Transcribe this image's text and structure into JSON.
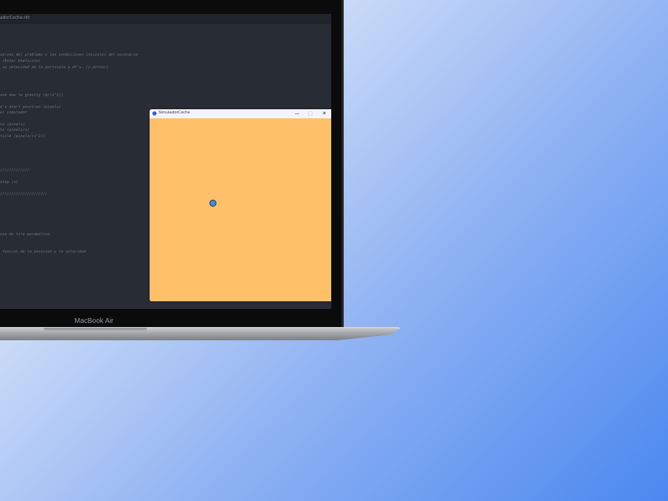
{
  "device": {
    "model_label": "MacBook Air"
  },
  "editor": {
    "title": "adorCoche.rkt",
    "code_lines": [
      "uerzas del problema y las condiciones iniciales del escenario",
      " (Euler Explicito)",
      " su velocidad de la particula a dt's. (y pintar)",
      "",
      "ion due to gravity (m/(s^2))",
      "e's start position (pixels)",
      "el simulador",
      "le (pixels)",
      "le (pixels/s)",
      "ticle (pixels/(s^2))",
      "/////////////",
      "step (s)",
      "/////////////////////",
      "cia de tiro parabolico.",
      " funcion de la posicion y la velocidad"
    ]
  },
  "sim_window": {
    "title": "SimuladorCoche",
    "minimize_symbol": "—",
    "maximize_symbol": "□",
    "close_symbol": "✕",
    "background_color": "#ffc06a",
    "particle_color": "#3d8ae6"
  },
  "colors": {
    "editor_bg": "#282c34",
    "desktop_gradient_end": "#4b88f0"
  }
}
